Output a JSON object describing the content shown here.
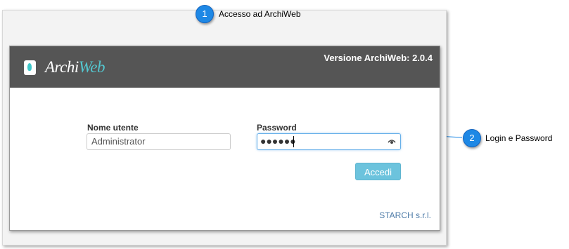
{
  "callouts": [
    {
      "number": "1",
      "text": "Accesso ad ArchiWeb"
    },
    {
      "number": "2",
      "text": "Login e Password"
    }
  ],
  "app": {
    "logo_prefix": "Archi",
    "logo_suffix": "Web",
    "version": "Versione ArchiWeb: 2.0.4"
  },
  "form": {
    "username_label": "Nome utente",
    "username_value": "Administrator",
    "password_label": "Password",
    "password_mask": "●●●●●●",
    "login_button": "Accedi"
  },
  "footer": {
    "company": "STARCH s.r.l."
  },
  "colors": {
    "header_bg": "#555555",
    "accent": "#54c6cf",
    "button": "#6cc3dd",
    "callout": "#1e88e5"
  }
}
